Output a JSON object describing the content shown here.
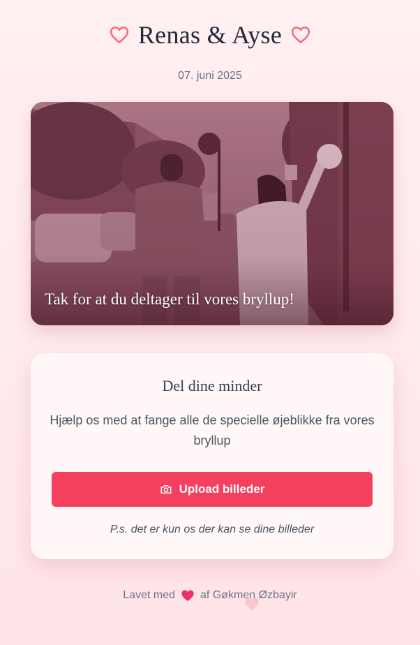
{
  "header": {
    "title": "Renas & Ayse",
    "date": "07. juni 2025"
  },
  "hero": {
    "caption": "Tak for at du deltager til vores bryllup!"
  },
  "card": {
    "title": "Del dine minder",
    "text": "Hjælp os med at fange alle de specielle øjeblikke fra vores bryllup",
    "upload_label": "Upload billeder",
    "note": "P.s. det er kun os der kan se dine billeder"
  },
  "footer": {
    "prefix": "Lavet med",
    "suffix": "af Gøkmen Øzbayir"
  },
  "icons": {
    "title_heart": "heart-outline-icon",
    "upload": "camera-icon",
    "footer_heart": "heart-icon"
  },
  "colors": {
    "accent": "#f43f5e",
    "heart_outline": "#f46a7e",
    "footer_heart": "#ec2f6e",
    "background": "#ffe9ec",
    "card": "#fff7f8"
  }
}
